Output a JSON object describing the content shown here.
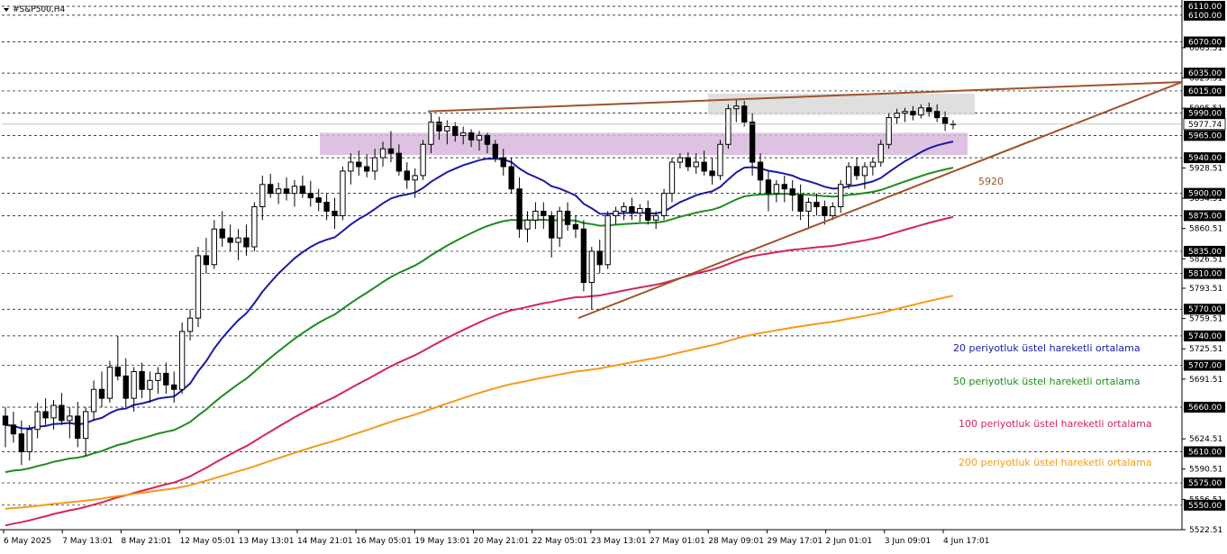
{
  "symbol_label": "#S&P500,H4",
  "colors": {
    "candle_up": "#ffffff",
    "candle_down": "#000000",
    "ema20": "#1a1aa6",
    "ema50": "#1e8c1e",
    "ema100": "#d6245a",
    "ema200": "#f59a1a",
    "trendline": "#a0522d",
    "zone_gray": "#d9d9d9",
    "zone_purple": "#d7b9dc",
    "price_tag_bg": "#000000",
    "current_price_tag_bg": "#ffffff"
  },
  "price_axis": {
    "levels_labeled": [
      6110.0,
      6100.0,
      6070.0,
      6035.0,
      6015.0,
      5990.0,
      5965.0,
      5940.0,
      5900.0,
      5875.0,
      5835.0,
      5810.0,
      5770.0,
      5740.0,
      5707.0,
      5660.0,
      5610.0,
      5575.0,
      5550.0
    ],
    "ticks_plain": [
      6063.51,
      6029.51,
      5995.51,
      5928.51,
      5894.51,
      5860.51,
      5826.51,
      5793.51,
      5759.51,
      5725.51,
      5691.51,
      5624.51,
      5590.51,
      5556.51,
      5522.51
    ],
    "current_price": 5977.74,
    "range": [
      5522.51,
      6113
    ]
  },
  "time_axis": {
    "labels": [
      "6 May 2025",
      "7 May 13:01",
      "8 May 21:01",
      "12 May 05:01",
      "13 May 13:01",
      "14 May 21:01",
      "16 May 05:01",
      "19 May 13:01",
      "20 May 21:01",
      "22 May 05:01",
      "23 May 13:01",
      "27 May 01:01",
      "28 May 09:01",
      "29 May 17:01",
      "2 Jun 01:01",
      "3 Jun 09:01",
      "4 Jun 17:01"
    ]
  },
  "annotations": {
    "trend_level_label": "5920"
  },
  "legend": [
    {
      "key": "ema20",
      "label": "20 periyotluk üstel hareketli ortalama"
    },
    {
      "key": "ema50",
      "label": "50 periyotluk üstel hareketli ortalama"
    },
    {
      "key": "ema100",
      "label": "100 periyotluk üstel hareketli ortalama"
    },
    {
      "key": "ema200",
      "label": "200 periyotluk üstel hareketli ortalama"
    }
  ],
  "chart_data": {
    "type": "candlestick",
    "title": "#S&P500,H4",
    "ylim": [
      5522.51,
      6113
    ],
    "ohlc": [
      [
        5650,
        5660,
        5615,
        5640
      ],
      [
        5640,
        5655,
        5620,
        5630
      ],
      [
        5630,
        5645,
        5595,
        5610
      ],
      [
        5610,
        5640,
        5600,
        5635
      ],
      [
        5635,
        5665,
        5625,
        5655
      ],
      [
        5655,
        5670,
        5640,
        5648
      ],
      [
        5648,
        5668,
        5635,
        5662
      ],
      [
        5662,
        5676,
        5640,
        5645
      ],
      [
        5645,
        5660,
        5625,
        5650
      ],
      [
        5650,
        5666,
        5615,
        5625
      ],
      [
        5625,
        5660,
        5605,
        5655
      ],
      [
        5655,
        5690,
        5645,
        5680
      ],
      [
        5680,
        5700,
        5660,
        5670
      ],
      [
        5670,
        5712,
        5665,
        5705
      ],
      [
        5705,
        5740,
        5690,
        5695
      ],
      [
        5695,
        5715,
        5660,
        5670
      ],
      [
        5670,
        5705,
        5655,
        5700
      ],
      [
        5700,
        5710,
        5670,
        5680
      ],
      [
        5680,
        5700,
        5665,
        5690
      ],
      [
        5690,
        5705,
        5675,
        5698
      ],
      [
        5698,
        5710,
        5675,
        5685
      ],
      [
        5685,
        5700,
        5665,
        5680
      ],
      [
        5680,
        5755,
        5675,
        5745
      ],
      [
        5745,
        5770,
        5735,
        5760
      ],
      [
        5760,
        5840,
        5750,
        5830
      ],
      [
        5830,
        5850,
        5810,
        5820
      ],
      [
        5820,
        5870,
        5815,
        5860
      ],
      [
        5860,
        5880,
        5840,
        5850
      ],
      [
        5850,
        5865,
        5835,
        5845
      ],
      [
        5845,
        5860,
        5825,
        5850
      ],
      [
        5850,
        5865,
        5830,
        5840
      ],
      [
        5840,
        5890,
        5835,
        5885
      ],
      [
        5885,
        5920,
        5870,
        5910
      ],
      [
        5910,
        5922,
        5895,
        5900
      ],
      [
        5900,
        5912,
        5888,
        5905
      ],
      [
        5905,
        5918,
        5892,
        5900
      ],
      [
        5900,
        5915,
        5885,
        5908
      ],
      [
        5908,
        5920,
        5895,
        5900
      ],
      [
        5900,
        5914,
        5885,
        5895
      ],
      [
        5895,
        5905,
        5880,
        5890
      ],
      [
        5890,
        5900,
        5870,
        5880
      ],
      [
        5880,
        5895,
        5860,
        5875
      ],
      [
        5875,
        5930,
        5870,
        5925
      ],
      [
        5925,
        5945,
        5910,
        5935
      ],
      [
        5935,
        5948,
        5920,
        5930
      ],
      [
        5930,
        5944,
        5918,
        5925
      ],
      [
        5925,
        5950,
        5915,
        5940
      ],
      [
        5940,
        5958,
        5930,
        5950
      ],
      [
        5950,
        5970,
        5935,
        5945
      ],
      [
        5945,
        5955,
        5920,
        5925
      ],
      [
        5925,
        5935,
        5905,
        5915
      ],
      [
        5915,
        5928,
        5895,
        5920
      ],
      [
        5920,
        5960,
        5915,
        5955
      ],
      [
        5955,
        5990,
        5945,
        5980
      ],
      [
        5980,
        5986,
        5960,
        5970
      ],
      [
        5970,
        5982,
        5955,
        5975
      ],
      [
        5975,
        5980,
        5958,
        5965
      ],
      [
        5965,
        5975,
        5955,
        5968
      ],
      [
        5968,
        5972,
        5952,
        5960
      ],
      [
        5960,
        5970,
        5948,
        5965
      ],
      [
        5965,
        5968,
        5945,
        5955
      ],
      [
        5955,
        5960,
        5935,
        5940
      ],
      [
        5940,
        5950,
        5920,
        5930
      ],
      [
        5930,
        5940,
        5900,
        5905
      ],
      [
        5905,
        5918,
        5850,
        5860
      ],
      [
        5860,
        5880,
        5845,
        5870
      ],
      [
        5870,
        5890,
        5860,
        5880
      ],
      [
        5880,
        5890,
        5860,
        5875
      ],
      [
        5875,
        5880,
        5828,
        5850
      ],
      [
        5850,
        5885,
        5840,
        5880
      ],
      [
        5880,
        5890,
        5858,
        5865
      ],
      [
        5865,
        5875,
        5850,
        5860
      ],
      [
        5860,
        5870,
        5790,
        5800
      ],
      [
        5800,
        5840,
        5770,
        5835
      ],
      [
        5835,
        5848,
        5810,
        5820
      ],
      [
        5820,
        5880,
        5815,
        5875
      ],
      [
        5875,
        5885,
        5865,
        5880
      ],
      [
        5880,
        5890,
        5870,
        5885
      ],
      [
        5885,
        5895,
        5870,
        5878
      ],
      [
        5878,
        5888,
        5868,
        5883
      ],
      [
        5883,
        5892,
        5865,
        5870
      ],
      [
        5870,
        5880,
        5860,
        5875
      ],
      [
        5875,
        5905,
        5870,
        5900
      ],
      [
        5900,
        5940,
        5890,
        5935
      ],
      [
        5935,
        5945,
        5928,
        5940
      ],
      [
        5940,
        5946,
        5925,
        5930
      ],
      [
        5930,
        5945,
        5922,
        5935
      ],
      [
        5935,
        5948,
        5920,
        5925
      ],
      [
        5925,
        5940,
        5910,
        5920
      ],
      [
        5920,
        5960,
        5915,
        5955
      ],
      [
        5955,
        6000,
        5950,
        5995
      ],
      [
        5995,
        6005,
        5980,
        5998
      ],
      [
        5998,
        6004,
        5975,
        5980
      ],
      [
        5980,
        5990,
        5920,
        5935
      ],
      [
        5935,
        5945,
        5900,
        5915
      ],
      [
        5915,
        5925,
        5880,
        5900
      ],
      [
        5900,
        5915,
        5890,
        5910
      ],
      [
        5910,
        5920,
        5890,
        5905
      ],
      [
        5905,
        5915,
        5880,
        5898
      ],
      [
        5898,
        5910,
        5870,
        5880
      ],
      [
        5880,
        5895,
        5860,
        5890
      ],
      [
        5890,
        5900,
        5875,
        5885
      ],
      [
        5885,
        5892,
        5865,
        5875
      ],
      [
        5875,
        5890,
        5870,
        5885
      ],
      [
        5885,
        5915,
        5878,
        5910
      ],
      [
        5910,
        5935,
        5905,
        5930
      ],
      [
        5930,
        5940,
        5915,
        5920
      ],
      [
        5920,
        5935,
        5905,
        5930
      ],
      [
        5930,
        5940,
        5920,
        5935
      ],
      [
        5935,
        5960,
        5930,
        5955
      ],
      [
        5955,
        5990,
        5950,
        5985
      ],
      [
        5985,
        5995,
        5978,
        5990
      ],
      [
        5990,
        5996,
        5980,
        5992
      ],
      [
        5992,
        5998,
        5982,
        5988
      ],
      [
        5988,
        6000,
        5984,
        5996
      ],
      [
        5996,
        6002,
        5986,
        5992
      ],
      [
        5992,
        6000,
        5980,
        5985
      ],
      [
        5985,
        5992,
        5970,
        5978
      ],
      [
        5978,
        5982,
        5972,
        5977.74
      ]
    ],
    "series": [
      {
        "name": "20 periyotluk üstel hareketli ortalama",
        "key": "ema20"
      },
      {
        "name": "50 periyotluk üstel hareketli ortalama",
        "key": "ema50"
      },
      {
        "name": "100 periyotluk üstel hareketli ortalama",
        "key": "ema100"
      },
      {
        "name": "200 periyotluk üstel hareketli ortalama",
        "key": "ema200"
      }
    ],
    "zones": [
      {
        "name": "gray-resistance-zone",
        "y": [
          5988,
          6012
        ]
      },
      {
        "name": "purple-support-zone",
        "y": [
          5943,
          5968
        ]
      }
    ],
    "trendlines": [
      {
        "name": "upper-trendline",
        "from": [
          "19 May 13:01",
          5992
        ],
        "to": [
          "extends right",
          6025
        ]
      },
      {
        "name": "rising-support-trendline",
        "from": [
          "23 May 13:01",
          5760
        ],
        "to": [
          "extends right",
          6025
        ]
      }
    ],
    "grid": true
  }
}
